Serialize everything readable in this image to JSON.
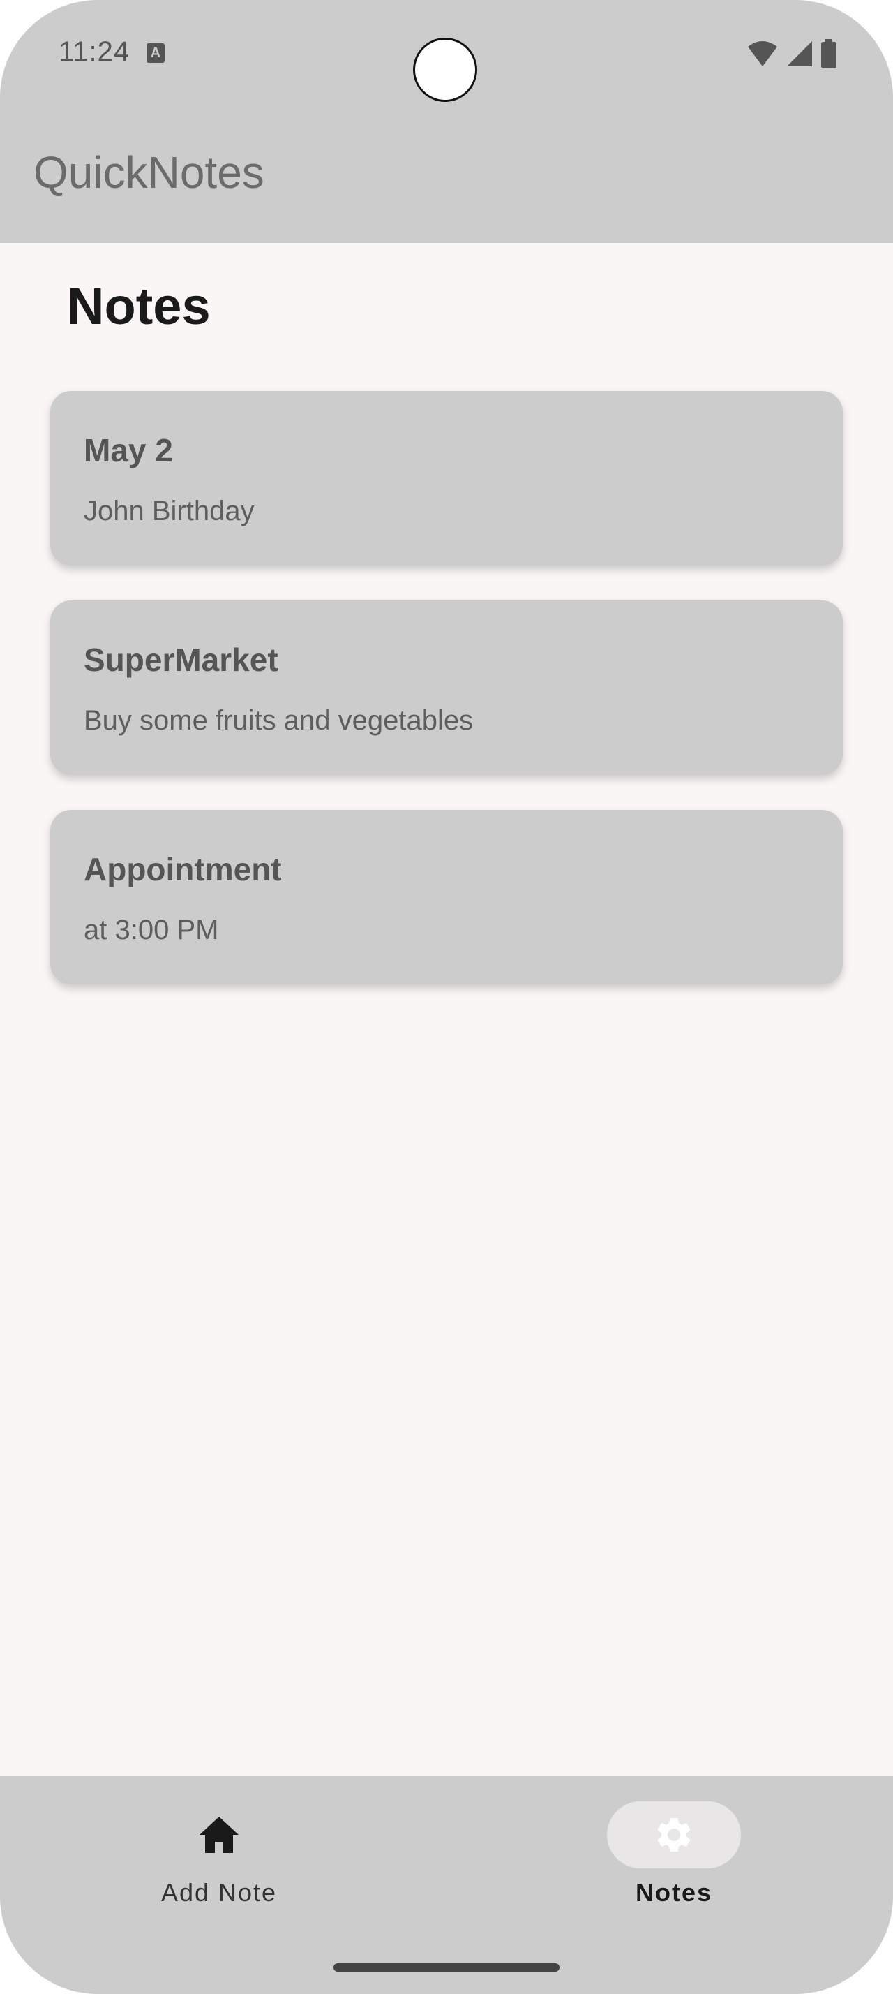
{
  "status_bar": {
    "time": "11:24",
    "notification_icon": "a-icon",
    "right_icons": [
      "wifi-icon",
      "signal-icon",
      "battery-icon"
    ]
  },
  "app_bar": {
    "title": "QuickNotes"
  },
  "page": {
    "heading": "Notes"
  },
  "notes": [
    {
      "title": "May 2",
      "body": "John Birthday"
    },
    {
      "title": "SuperMarket",
      "body": "Buy some fruits and vegetables"
    },
    {
      "title": "Appointment",
      "body": "at 3:00 PM"
    }
  ],
  "bottom_nav": {
    "items": [
      {
        "label": "Add Note",
        "icon": "home-icon",
        "selected": false
      },
      {
        "label": "Notes",
        "icon": "gear-icon",
        "selected": true
      }
    ]
  },
  "colors": {
    "bar_background": "#cccccc",
    "page_background": "#f9f6f5",
    "card_background": "#cccccc",
    "active_indicator": "#e8e6e6"
  }
}
